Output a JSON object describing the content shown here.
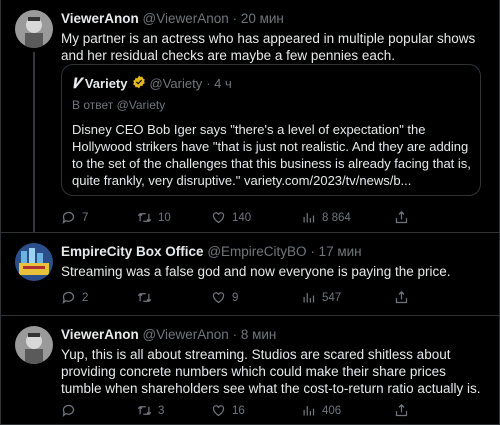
{
  "tweets": [
    {
      "name": "ViewerAnon",
      "handle": "@ViewerAnon",
      "time": "· 20 мин",
      "text": "My partner is an actress who has appeared in multiple popular shows and her residual checks are maybe a few pennies each.",
      "quote": {
        "name": "Variety",
        "handle": "@Variety",
        "time": "· 4 ч",
        "reply_to": "В ответ @Variety",
        "text": "Disney CEO Bob Iger says \"there's a level of expectation\" the Hollywood strikers have \"that is just not realistic. And they are adding to the set of the challenges that this business is already facing that is, quite frankly, very disruptive.\" variety.com/2023/tv/news/b..."
      },
      "replies": "7",
      "retweets": "10",
      "likes": "140",
      "views": "8 864"
    },
    {
      "name": "EmpireCity Box Office",
      "handle": "@EmpireCityBO",
      "time": "· 17 мин",
      "text": "Streaming was a false god and now everyone is paying the price.",
      "replies": "2",
      "retweets": "",
      "likes": "9",
      "views": "547"
    },
    {
      "name": "ViewerAnon",
      "handle": "@ViewerAnon",
      "time": "· 8 мин",
      "text": "Yup, this is all about streaming. Studios are scared shitless about providing concrete numbers which could make their share prices tumble when shareholders see what the cost-to-return ratio actually is.",
      "replies": "",
      "retweets": "3",
      "likes": "16",
      "views": "406"
    }
  ],
  "colors": {
    "background": "#000000",
    "text": "#e7e9ea",
    "muted": "#71767b",
    "border": "#2f3336",
    "verified_gold": "#e2b719"
  }
}
